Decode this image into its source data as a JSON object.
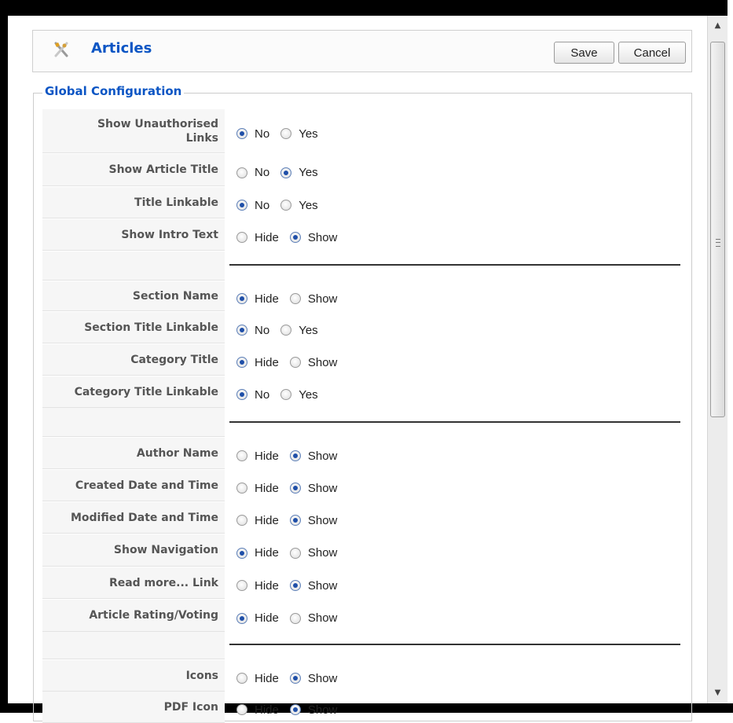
{
  "header": {
    "title": "Articles",
    "save_label": "Save",
    "cancel_label": "Cancel",
    "icon": "articles-icon"
  },
  "fieldset": {
    "legend": "Global Configuration"
  },
  "rows": [
    {
      "label_line1": "Show Unauthorised",
      "label_line2": "Links",
      "options": [
        "No",
        "Yes"
      ],
      "selected": "No"
    },
    {
      "label": "Show Article Title",
      "options": [
        "No",
        "Yes"
      ],
      "selected": "Yes"
    },
    {
      "label": "Title Linkable",
      "options": [
        "No",
        "Yes"
      ],
      "selected": "No"
    },
    {
      "label": "Show Intro Text",
      "options": [
        "Hide",
        "Show"
      ],
      "selected": "Show"
    },
    {
      "label": "Section Name",
      "options": [
        "Hide",
        "Show"
      ],
      "selected": "Hide"
    },
    {
      "label": "Section Title Linkable",
      "options": [
        "No",
        "Yes"
      ],
      "selected": "No"
    },
    {
      "label": "Category Title",
      "options": [
        "Hide",
        "Show"
      ],
      "selected": "Hide"
    },
    {
      "label": "Category Title Linkable",
      "options": [
        "No",
        "Yes"
      ],
      "selected": "No"
    },
    {
      "label": "Author Name",
      "options": [
        "Hide",
        "Show"
      ],
      "selected": "Show"
    },
    {
      "label": "Created Date and Time",
      "options": [
        "Hide",
        "Show"
      ],
      "selected": "Show"
    },
    {
      "label": "Modified Date and Time",
      "options": [
        "Hide",
        "Show"
      ],
      "selected": "Show"
    },
    {
      "label": "Show Navigation",
      "options": [
        "Hide",
        "Show"
      ],
      "selected": "Hide"
    },
    {
      "label": "Read more... Link",
      "options": [
        "Hide",
        "Show"
      ],
      "selected": "Show"
    },
    {
      "label": "Article Rating/Voting",
      "options": [
        "Hide",
        "Show"
      ],
      "selected": "Hide"
    },
    {
      "label": "Icons",
      "options": [
        "Hide",
        "Show"
      ],
      "selected": "Show"
    },
    {
      "label": "PDF Icon",
      "options": [
        "Hide",
        "Show"
      ],
      "selected": "Show"
    }
  ],
  "colors": {
    "accent": "#0b55c4",
    "label_bg": "#f6f6f6",
    "radio_selected": "#1f4fa8"
  }
}
